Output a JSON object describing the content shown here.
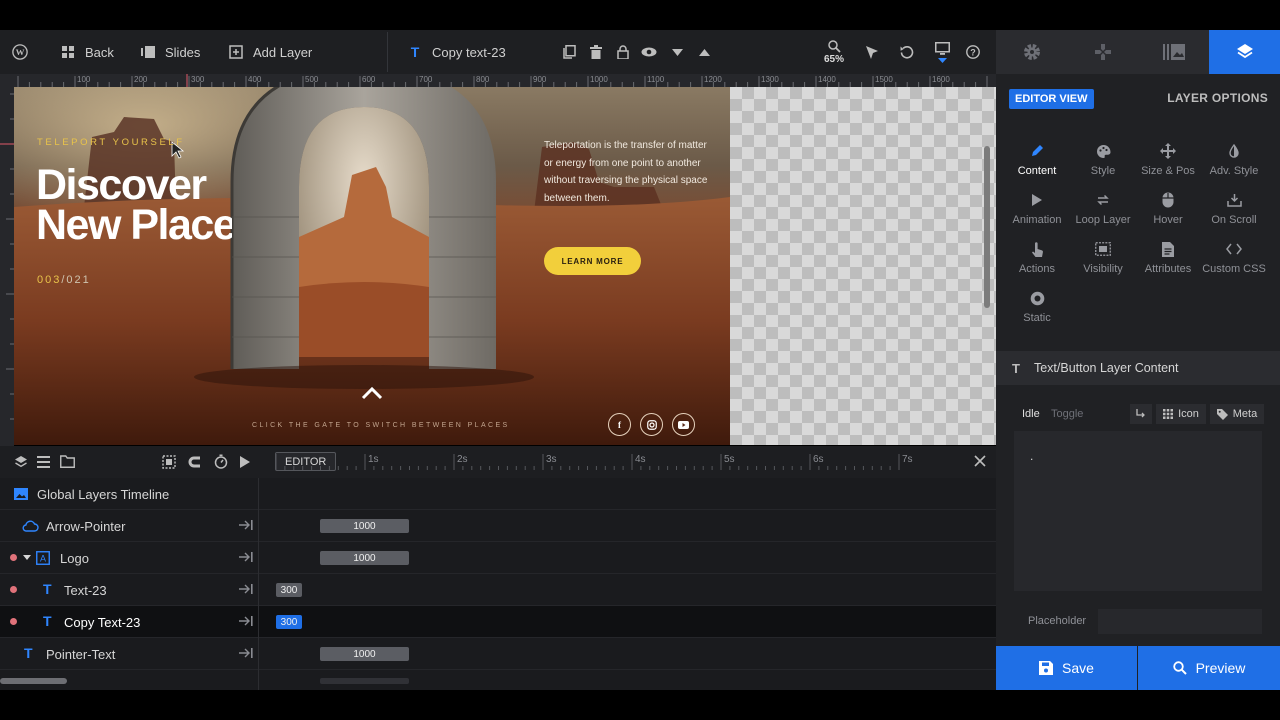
{
  "topbar": {
    "back_label": "Back",
    "slides_label": "Slides",
    "add_layer_label": "Add Layer",
    "current_layer": "Copy text-23",
    "zoom_level": "65%"
  },
  "ruler": {
    "ticks": [
      "100",
      "200",
      "300",
      "400",
      "500",
      "600",
      "700",
      "800",
      "900",
      "1000",
      "1100",
      "1200",
      "1300",
      "1400",
      "1500",
      "1600"
    ]
  },
  "slide": {
    "kicker": "TELEPORT YOURSELF",
    "headline_line1": "Discover",
    "headline_line2": "New Places",
    "counter_current": "003",
    "counter_total": "/021",
    "description": "Teleportation is the transfer of matter or energy from one point to another without traversing the physical space between them.",
    "button_label": "LEARN MORE",
    "footer_hint": "CLICK THE GATE TO SWITCH BETWEEN PLACES",
    "social": [
      "f",
      "ig",
      "yt"
    ]
  },
  "timeline": {
    "editor_label": "EDITOR",
    "seconds": [
      "1s",
      "2s",
      "3s",
      "4s",
      "5s",
      "6s",
      "7s"
    ],
    "global_label": "Global Layers Timeline",
    "rows": [
      {
        "name": "Arrow-Pointer",
        "duration": "1000"
      },
      {
        "name": "Logo",
        "duration": "1000"
      },
      {
        "name": "Text-23",
        "duration": "300"
      },
      {
        "name": "Copy Text-23",
        "duration": "300"
      },
      {
        "name": "Pointer-Text",
        "duration": "1000"
      }
    ]
  },
  "panel": {
    "editor_view": "EDITOR VIEW",
    "layer_options": "LAYER OPTIONS",
    "options": [
      "Content",
      "Style",
      "Size & Pos",
      "Adv. Style",
      "Animation",
      "Loop Layer",
      "Hover",
      "On Scroll",
      "Actions",
      "Visibility",
      "Attributes",
      "Custom CSS",
      "Static"
    ],
    "content_header": "Text/Button Layer Content",
    "idle_label": "Idle",
    "toggle_label": "Toggle",
    "icon_label": "Icon",
    "meta_label": "Meta",
    "content_value": ".",
    "placeholder_label": "Placeholder",
    "save_label": "Save",
    "preview_label": "Preview"
  },
  "colors": {
    "accent": "#1f6fe6",
    "gold": "#f2cf3b",
    "panel_bg": "#202124"
  }
}
